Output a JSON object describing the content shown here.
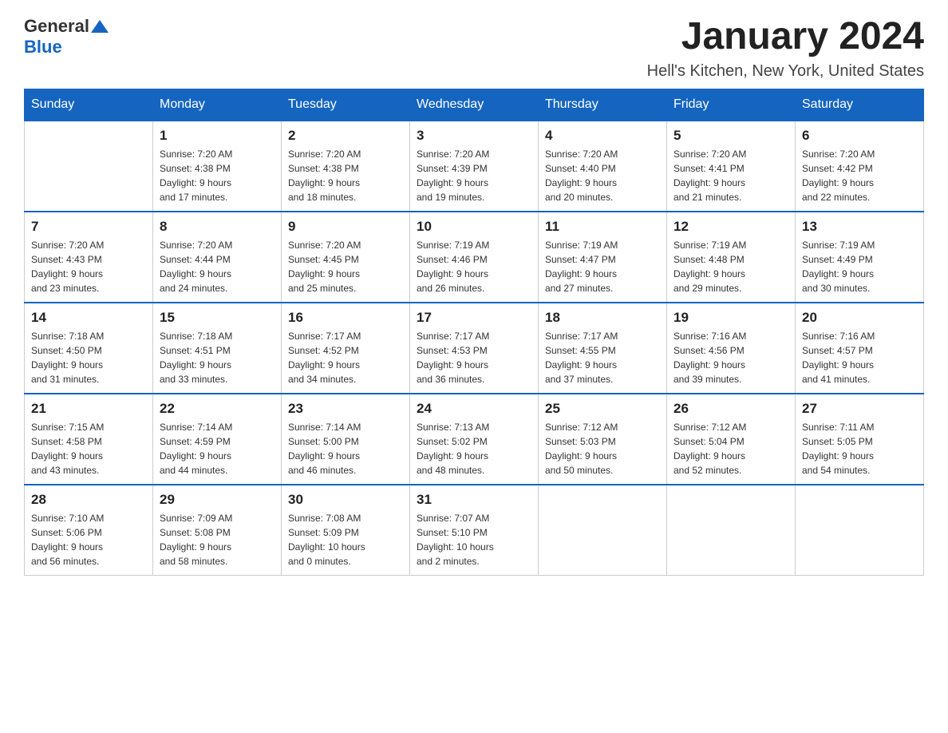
{
  "header": {
    "logo_general": "General",
    "logo_blue": "Blue",
    "month_title": "January 2024",
    "location": "Hell's Kitchen, New York, United States"
  },
  "days_of_week": [
    "Sunday",
    "Monday",
    "Tuesday",
    "Wednesday",
    "Thursday",
    "Friday",
    "Saturday"
  ],
  "weeks": [
    [
      {
        "day": "",
        "info": ""
      },
      {
        "day": "1",
        "info": "Sunrise: 7:20 AM\nSunset: 4:38 PM\nDaylight: 9 hours\nand 17 minutes."
      },
      {
        "day": "2",
        "info": "Sunrise: 7:20 AM\nSunset: 4:38 PM\nDaylight: 9 hours\nand 18 minutes."
      },
      {
        "day": "3",
        "info": "Sunrise: 7:20 AM\nSunset: 4:39 PM\nDaylight: 9 hours\nand 19 minutes."
      },
      {
        "day": "4",
        "info": "Sunrise: 7:20 AM\nSunset: 4:40 PM\nDaylight: 9 hours\nand 20 minutes."
      },
      {
        "day": "5",
        "info": "Sunrise: 7:20 AM\nSunset: 4:41 PM\nDaylight: 9 hours\nand 21 minutes."
      },
      {
        "day": "6",
        "info": "Sunrise: 7:20 AM\nSunset: 4:42 PM\nDaylight: 9 hours\nand 22 minutes."
      }
    ],
    [
      {
        "day": "7",
        "info": "Sunrise: 7:20 AM\nSunset: 4:43 PM\nDaylight: 9 hours\nand 23 minutes."
      },
      {
        "day": "8",
        "info": "Sunrise: 7:20 AM\nSunset: 4:44 PM\nDaylight: 9 hours\nand 24 minutes."
      },
      {
        "day": "9",
        "info": "Sunrise: 7:20 AM\nSunset: 4:45 PM\nDaylight: 9 hours\nand 25 minutes."
      },
      {
        "day": "10",
        "info": "Sunrise: 7:19 AM\nSunset: 4:46 PM\nDaylight: 9 hours\nand 26 minutes."
      },
      {
        "day": "11",
        "info": "Sunrise: 7:19 AM\nSunset: 4:47 PM\nDaylight: 9 hours\nand 27 minutes."
      },
      {
        "day": "12",
        "info": "Sunrise: 7:19 AM\nSunset: 4:48 PM\nDaylight: 9 hours\nand 29 minutes."
      },
      {
        "day": "13",
        "info": "Sunrise: 7:19 AM\nSunset: 4:49 PM\nDaylight: 9 hours\nand 30 minutes."
      }
    ],
    [
      {
        "day": "14",
        "info": "Sunrise: 7:18 AM\nSunset: 4:50 PM\nDaylight: 9 hours\nand 31 minutes."
      },
      {
        "day": "15",
        "info": "Sunrise: 7:18 AM\nSunset: 4:51 PM\nDaylight: 9 hours\nand 33 minutes."
      },
      {
        "day": "16",
        "info": "Sunrise: 7:17 AM\nSunset: 4:52 PM\nDaylight: 9 hours\nand 34 minutes."
      },
      {
        "day": "17",
        "info": "Sunrise: 7:17 AM\nSunset: 4:53 PM\nDaylight: 9 hours\nand 36 minutes."
      },
      {
        "day": "18",
        "info": "Sunrise: 7:17 AM\nSunset: 4:55 PM\nDaylight: 9 hours\nand 37 minutes."
      },
      {
        "day": "19",
        "info": "Sunrise: 7:16 AM\nSunset: 4:56 PM\nDaylight: 9 hours\nand 39 minutes."
      },
      {
        "day": "20",
        "info": "Sunrise: 7:16 AM\nSunset: 4:57 PM\nDaylight: 9 hours\nand 41 minutes."
      }
    ],
    [
      {
        "day": "21",
        "info": "Sunrise: 7:15 AM\nSunset: 4:58 PM\nDaylight: 9 hours\nand 43 minutes."
      },
      {
        "day": "22",
        "info": "Sunrise: 7:14 AM\nSunset: 4:59 PM\nDaylight: 9 hours\nand 44 minutes."
      },
      {
        "day": "23",
        "info": "Sunrise: 7:14 AM\nSunset: 5:00 PM\nDaylight: 9 hours\nand 46 minutes."
      },
      {
        "day": "24",
        "info": "Sunrise: 7:13 AM\nSunset: 5:02 PM\nDaylight: 9 hours\nand 48 minutes."
      },
      {
        "day": "25",
        "info": "Sunrise: 7:12 AM\nSunset: 5:03 PM\nDaylight: 9 hours\nand 50 minutes."
      },
      {
        "day": "26",
        "info": "Sunrise: 7:12 AM\nSunset: 5:04 PM\nDaylight: 9 hours\nand 52 minutes."
      },
      {
        "day": "27",
        "info": "Sunrise: 7:11 AM\nSunset: 5:05 PM\nDaylight: 9 hours\nand 54 minutes."
      }
    ],
    [
      {
        "day": "28",
        "info": "Sunrise: 7:10 AM\nSunset: 5:06 PM\nDaylight: 9 hours\nand 56 minutes."
      },
      {
        "day": "29",
        "info": "Sunrise: 7:09 AM\nSunset: 5:08 PM\nDaylight: 9 hours\nand 58 minutes."
      },
      {
        "day": "30",
        "info": "Sunrise: 7:08 AM\nSunset: 5:09 PM\nDaylight: 10 hours\nand 0 minutes."
      },
      {
        "day": "31",
        "info": "Sunrise: 7:07 AM\nSunset: 5:10 PM\nDaylight: 10 hours\nand 2 minutes."
      },
      {
        "day": "",
        "info": ""
      },
      {
        "day": "",
        "info": ""
      },
      {
        "day": "",
        "info": ""
      }
    ]
  ]
}
